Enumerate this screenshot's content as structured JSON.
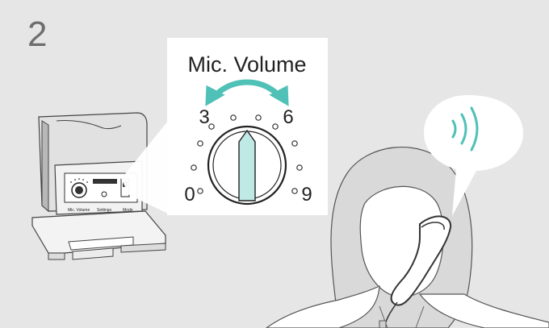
{
  "step": {
    "number": "2"
  },
  "dial": {
    "title": "Mic. Volume",
    "labels": {
      "min": "0",
      "low": "3",
      "high": "6",
      "max": "9"
    }
  },
  "base": {
    "labels": {
      "mic_volume": "Mic. Volume",
      "settings": "Settings",
      "mode": "Mode"
    }
  },
  "colors": {
    "background": "#e6e6e6",
    "accent": "#4fc1b7",
    "line": "#2b2b2b",
    "panel": "#ffffff"
  },
  "icons": [
    "sound-waves-icon",
    "arrow-both-ways-icon",
    "telephone-handset-icon"
  ]
}
